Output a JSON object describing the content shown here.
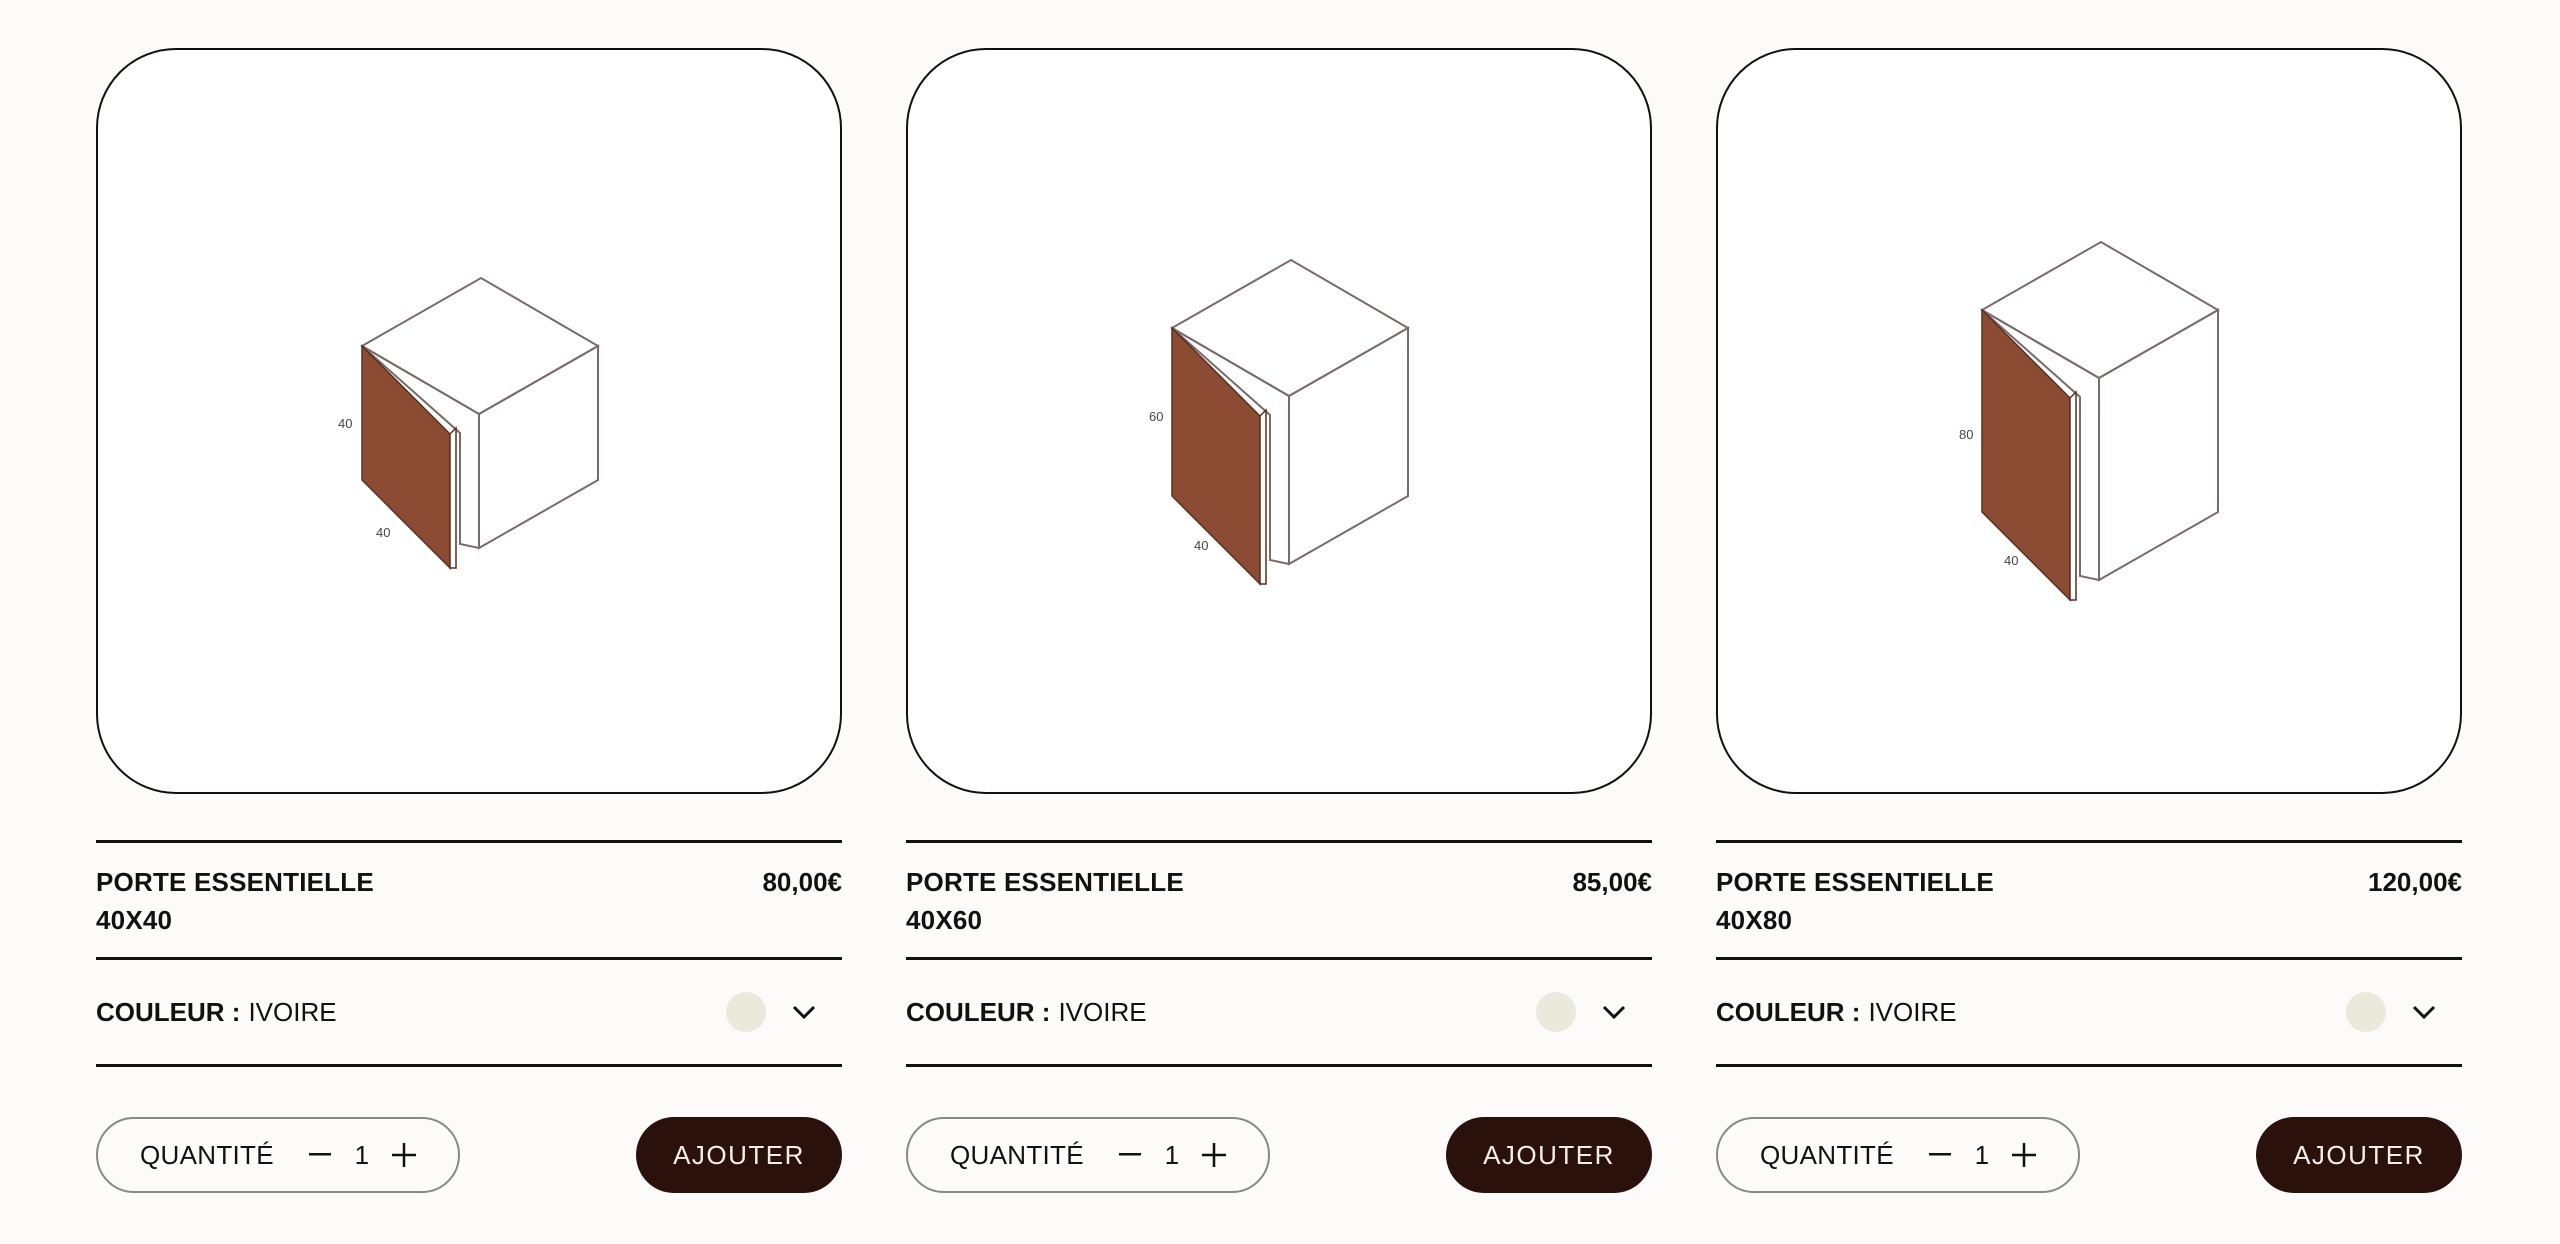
{
  "colors": {
    "door": "#8b4c33",
    "swatch_ivoire": "#ebe8dc",
    "button_bg": "#2b110c",
    "button_text": "#f4efe8"
  },
  "products": [
    {
      "name_line1": "PORTE ESSENTIELLE",
      "name_line2": "40X40",
      "price": "80,00€",
      "dim_height": "40",
      "dim_width": "40",
      "color_label": "COULEUR :",
      "color_value": "IVOIRE",
      "qty_label": "QUANTITÉ",
      "qty_value": "1",
      "add_label": "AJOUTER"
    },
    {
      "name_line1": "PORTE ESSENTIELLE",
      "name_line2": "40X60",
      "price": "85,00€",
      "dim_height": "60",
      "dim_width": "40",
      "color_label": "COULEUR :",
      "color_value": "IVOIRE",
      "qty_label": "QUANTITÉ",
      "qty_value": "1",
      "add_label": "AJOUTER"
    },
    {
      "name_line1": "PORTE ESSENTIELLE",
      "name_line2": "40X80",
      "price": "120,00€",
      "dim_height": "80",
      "dim_width": "40",
      "color_label": "COULEUR :",
      "color_value": "IVOIRE",
      "qty_label": "QUANTITÉ",
      "qty_value": "1",
      "add_label": "AJOUTER"
    }
  ],
  "icons": {
    "chevron": "chevron-down-icon",
    "minus": "minus-icon",
    "plus": "plus-icon"
  }
}
